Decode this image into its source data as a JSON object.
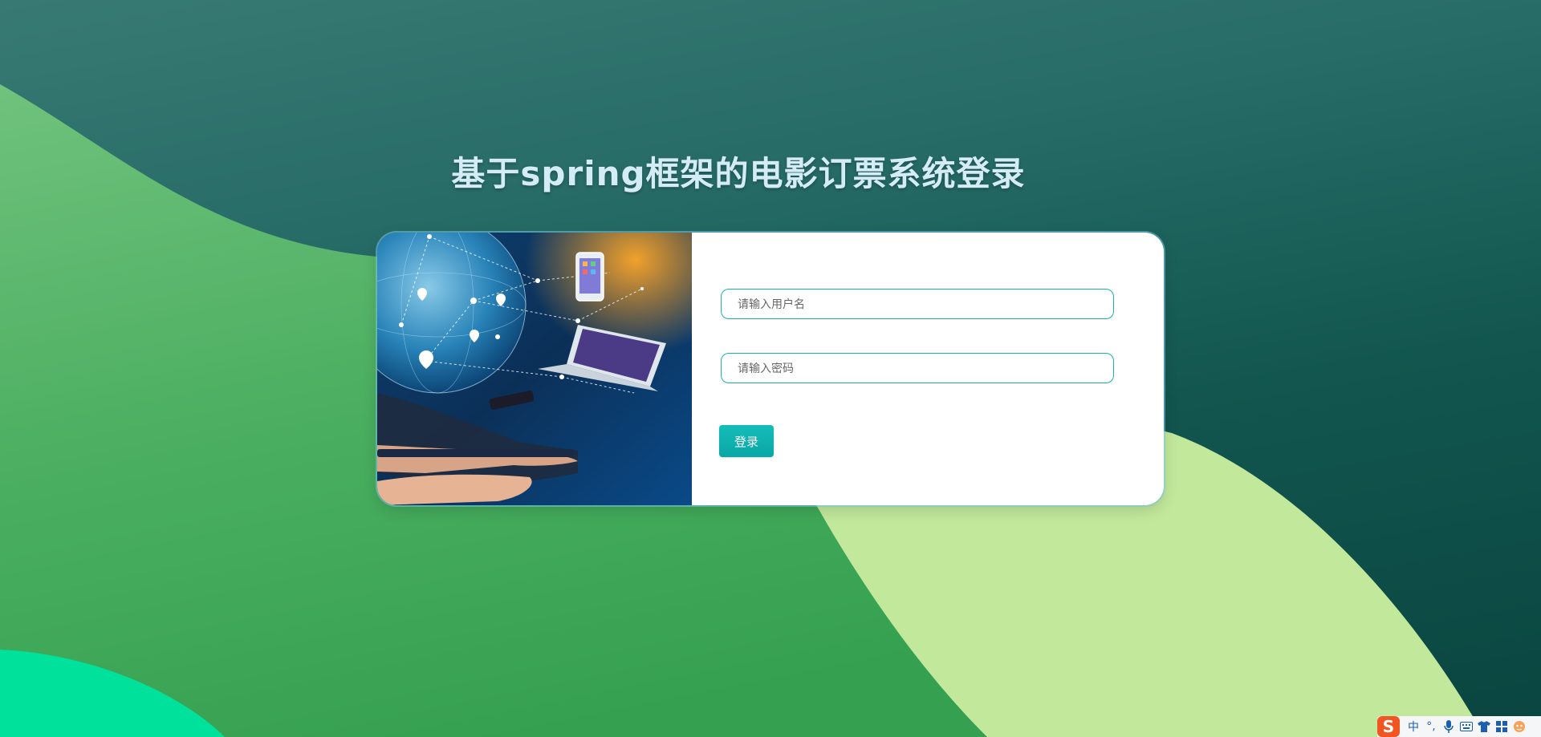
{
  "page": {
    "title": "基于spring框架的电影订票系统登录"
  },
  "login_form": {
    "username_placeholder": "请输入用户名",
    "password_placeholder": "请输入密码",
    "login_label": "登录"
  },
  "ime_toolbar": {
    "logo": "S",
    "mode_label": "中",
    "punctuation_label": "°,",
    "icons": [
      "microphone-icon",
      "keyboard-icon",
      "skin-icon",
      "toolbox-icon",
      "mascot-icon"
    ]
  },
  "colors": {
    "title": "#d4ecf6",
    "input_border": "#19b4a6",
    "button": "#10b2b0",
    "bg_dark_teal": "#276b67",
    "shape_green": "#4caf62",
    "shape_light_green": "#c2e89b",
    "shape_mint": "#00e19b"
  }
}
